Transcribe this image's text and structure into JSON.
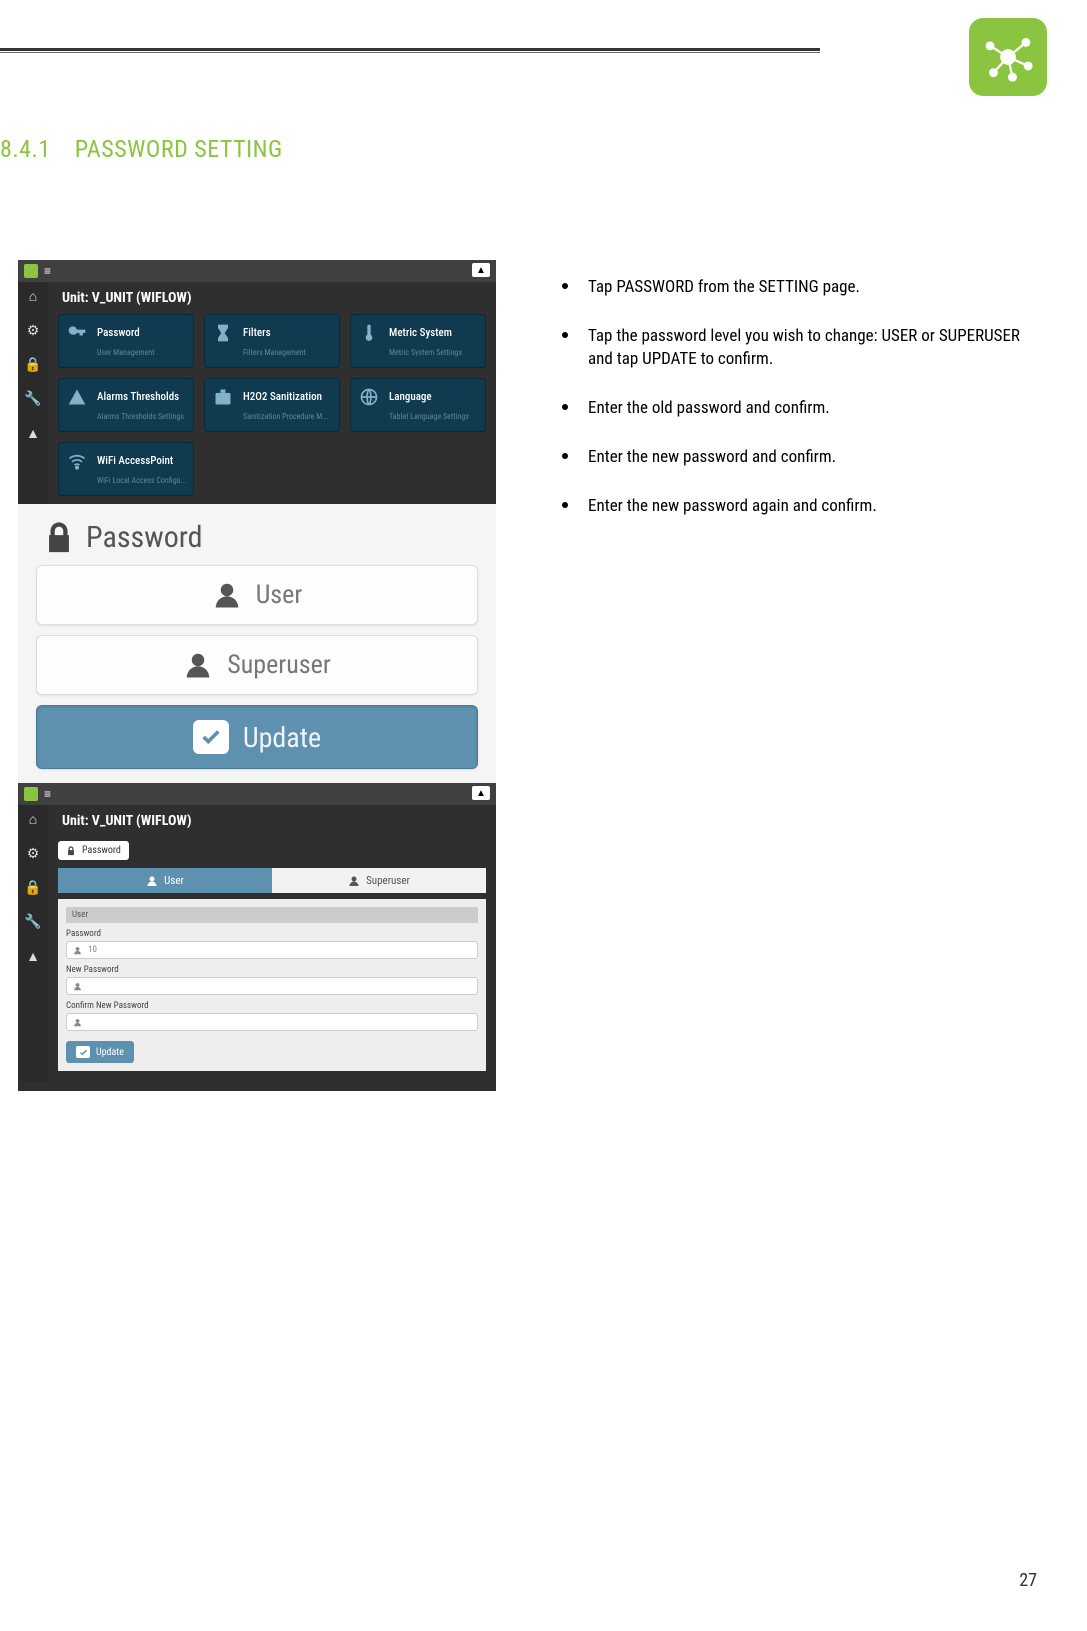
{
  "page_number": "27",
  "section": {
    "number": "8.4.1",
    "title": "PASSWORD SETTING"
  },
  "instructions": [
    "Tap PASSWORD from the SETTING page.",
    "Tap the password level you wish to change: USER or SUPERUSER and tap UPDATE to confirm.",
    "Enter the old password and confirm.",
    "Enter the new password and confirm.",
    "Enter the new password again and confirm."
  ],
  "shot1": {
    "unit_title": "Unit: V_UNIT (WIFLOW)",
    "crumb": "",
    "tiles": [
      {
        "title": "Password",
        "sub": "User Management"
      },
      {
        "title": "Filters",
        "sub": "Filters Management"
      },
      {
        "title": "Metric System",
        "sub": "Metric System Settings"
      },
      {
        "title": "Alarms Thresholds",
        "sub": "Alarms Thresholds Settings"
      },
      {
        "title": "H2O2 Sanitization",
        "sub": "Sanitization Procedure M..."
      },
      {
        "title": "Language",
        "sub": "Tablet Language Settings"
      },
      {
        "title": "WiFi AccessPoint",
        "sub": "WiFi Local Access Configu..."
      }
    ]
  },
  "shot2": {
    "header": "Password",
    "row_user": "User",
    "row_superuser": "Superuser",
    "row_update": "Update"
  },
  "shot3": {
    "unit_title": "Unit: V_UNIT (WIFLOW)",
    "crumb_label": "Password",
    "tab_user": "User",
    "tab_superuser": "Superuser",
    "section_user": "User",
    "label_password": "Password",
    "value_password": "10",
    "label_new": "New Password",
    "label_confirm": "Confirm New Password",
    "update": "Update"
  }
}
